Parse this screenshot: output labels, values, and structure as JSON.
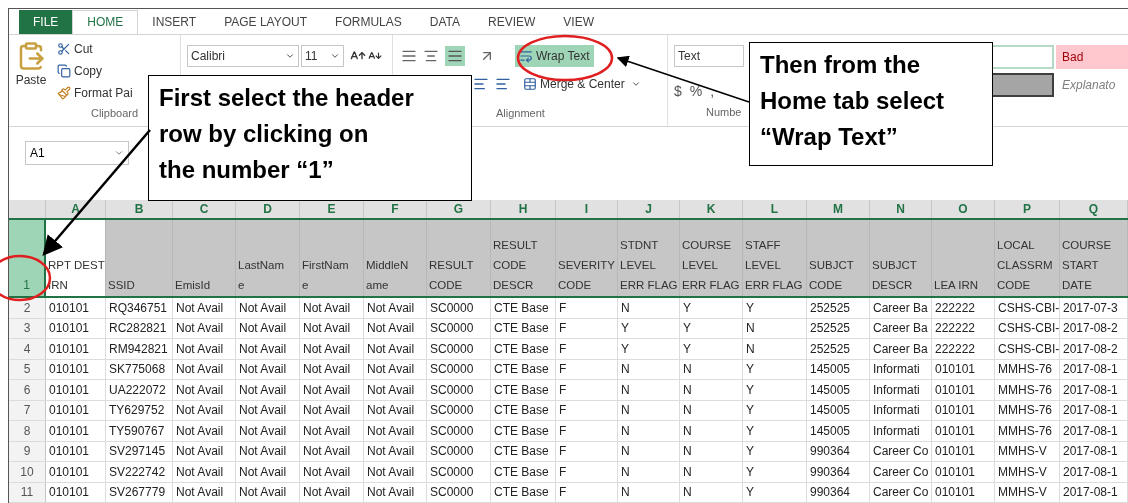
{
  "tabs": [
    {
      "label": "FILE",
      "kind": "file",
      "selected": false
    },
    {
      "label": "HOME",
      "kind": "tab",
      "selected": true
    },
    {
      "label": "INSERT",
      "kind": "tab",
      "selected": false
    },
    {
      "label": "PAGE LAYOUT",
      "kind": "tab",
      "selected": false
    },
    {
      "label": "FORMULAS",
      "kind": "tab",
      "selected": false
    },
    {
      "label": "DATA",
      "kind": "tab",
      "selected": false
    },
    {
      "label": "REVIEW",
      "kind": "tab",
      "selected": false
    },
    {
      "label": "VIEW",
      "kind": "tab",
      "selected": false
    }
  ],
  "ribbon": {
    "clipboard": {
      "paste": "Paste",
      "cut": "Cut",
      "copy": "Copy",
      "format_painter": "Format Pai",
      "label": "Clipboard"
    },
    "font": {
      "name": "Calibri",
      "size": "11"
    },
    "alignment": {
      "wrap_text": {
        "label": "Wrap Text",
        "on": true
      },
      "merge": "Merge & Center",
      "label": "Alignment"
    },
    "number": {
      "format": "Text",
      "currency": "$",
      "percent": "%",
      "comma": ",",
      "label": "Numbe"
    },
    "styles": [
      {
        "label": "Bad",
        "kind": "bad"
      },
      {
        "label": "Explanato",
        "kind": "explanatory"
      }
    ]
  },
  "name_box": "A1",
  "sheet": {
    "columns": [
      "A",
      "B",
      "C",
      "D",
      "E",
      "F",
      "G",
      "H",
      "I",
      "J",
      "K",
      "L",
      "M",
      "N",
      "O",
      "P",
      "Q"
    ],
    "header_row": {
      "number": "1",
      "selected": true,
      "cells": [
        [
          "RPT DEST",
          "IRN"
        ],
        [
          "SSID"
        ],
        [
          "EmisId"
        ],
        [
          "LastNam",
          "e"
        ],
        [
          "FirstNam",
          "e"
        ],
        [
          "MiddleN",
          "ame"
        ],
        [
          "RESULT",
          "CODE"
        ],
        [
          "RESULT",
          "CODE",
          "DESCR"
        ],
        [
          "SEVERITY",
          "CODE"
        ],
        [
          "STDNT",
          "LEVEL",
          "ERR FLAG"
        ],
        [
          "COURSE",
          "LEVEL",
          "ERR FLAG"
        ],
        [
          "STAFF",
          "LEVEL",
          "ERR FLAG"
        ],
        [
          "SUBJCT",
          "CODE"
        ],
        [
          "SUBJCT",
          "DESCR"
        ],
        [
          "LEA IRN"
        ],
        [
          "LOCAL",
          "CLASSRM",
          "CODE"
        ],
        [
          "COURSE",
          "START",
          "DATE"
        ]
      ]
    },
    "rows": [
      {
        "number": "2",
        "cells": [
          "010101",
          "RQ346751",
          "Not Avail",
          "Not Avail",
          "Not Avail",
          "Not Avail",
          "SC0000",
          "CTE Base",
          "F",
          "N",
          "Y",
          "Y",
          "252525",
          "Career Ba",
          "222222",
          "CSHS-CBI-",
          "2017-07-3"
        ]
      },
      {
        "number": "3",
        "cells": [
          "010101",
          "RC282821",
          "Not Avail",
          "Not Avail",
          "Not Avail",
          "Not Avail",
          "SC0000",
          "CTE Base",
          "F",
          "Y",
          "Y",
          "N",
          "252525",
          "Career Ba",
          "222222",
          "CSHS-CBI-",
          "2017-08-2"
        ]
      },
      {
        "number": "4",
        "cells": [
          "010101",
          "RM942821",
          "Not Avail",
          "Not Avail",
          "Not Avail",
          "Not Avail",
          "SC0000",
          "CTE Base",
          "F",
          "Y",
          "Y",
          "N",
          "252525",
          "Career Ba",
          "222222",
          "CSHS-CBI-",
          "2017-08-2"
        ]
      },
      {
        "number": "5",
        "cells": [
          "010101",
          "SK775068",
          "Not Avail",
          "Not Avail",
          "Not Avail",
          "Not Avail",
          "SC0000",
          "CTE Base",
          "F",
          "N",
          "N",
          "Y",
          "145005",
          "Informati",
          "010101",
          "MMHS-76",
          "2017-08-1"
        ]
      },
      {
        "number": "6",
        "cells": [
          "010101",
          "UA222072",
          "Not Avail",
          "Not Avail",
          "Not Avail",
          "Not Avail",
          "SC0000",
          "CTE Base",
          "F",
          "N",
          "N",
          "Y",
          "145005",
          "Informati",
          "010101",
          "MMHS-76",
          "2017-08-1"
        ]
      },
      {
        "number": "7",
        "cells": [
          "010101",
          "TY629752",
          "Not Avail",
          "Not Avail",
          "Not Avail",
          "Not Avail",
          "SC0000",
          "CTE Base",
          "F",
          "N",
          "N",
          "Y",
          "145005",
          "Informati",
          "010101",
          "MMHS-76",
          "2017-08-1"
        ]
      },
      {
        "number": "8",
        "cells": [
          "010101",
          "TY590767",
          "Not Avail",
          "Not Avail",
          "Not Avail",
          "Not Avail",
          "SC0000",
          "CTE Base",
          "F",
          "N",
          "N",
          "Y",
          "145005",
          "Informati",
          "010101",
          "MMHS-76",
          "2017-08-1"
        ]
      },
      {
        "number": "9",
        "cells": [
          "010101",
          "SV297145",
          "Not Avail",
          "Not Avail",
          "Not Avail",
          "Not Avail",
          "SC0000",
          "CTE Base",
          "F",
          "N",
          "N",
          "Y",
          "990364",
          "Career Co",
          "010101",
          "MMHS-V",
          "2017-08-1"
        ]
      },
      {
        "number": "10",
        "cells": [
          "010101",
          "SV222742",
          "Not Avail",
          "Not Avail",
          "Not Avail",
          "Not Avail",
          "SC0000",
          "CTE Base",
          "F",
          "N",
          "N",
          "Y",
          "990364",
          "Career Co",
          "010101",
          "MMHS-V",
          "2017-08-1"
        ]
      },
      {
        "number": "11",
        "cells": [
          "010101",
          "SV267779",
          "Not Avail",
          "Not Avail",
          "Not Avail",
          "Not Avail",
          "SC0000",
          "CTE Base",
          "F",
          "N",
          "N",
          "Y",
          "990364",
          "Career Co",
          "010101",
          "MMHS-V",
          "2017-08-1"
        ]
      }
    ]
  },
  "callouts": [
    {
      "kind": "header",
      "lines": [
        "First select the header",
        "row by clicking on",
        "the number “1”"
      ]
    },
    {
      "kind": "wrap",
      "lines": [
        "Then from the",
        "Home tab select",
        "“Wrap Text”"
      ]
    }
  ]
}
